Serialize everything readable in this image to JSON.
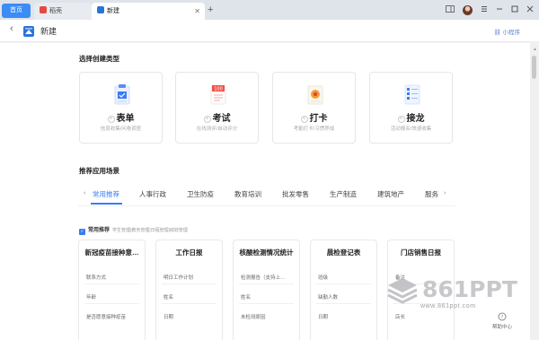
{
  "browser": {
    "home_tab": "首页",
    "tabs": [
      {
        "label": "稻壳",
        "active": false,
        "icon_color": "#e5483f",
        "icon": "daoke-icon"
      },
      {
        "label": "新建",
        "active": true,
        "icon_color": "#2a74d8",
        "icon": "app-icon"
      }
    ],
    "add_tab": "+",
    "close_glyph": "✕",
    "accent": "#3b8cf5"
  },
  "header": {
    "back": "‹",
    "title": "新建",
    "mini_program": "小程序"
  },
  "create_section": {
    "title": "选择创建类型",
    "cards": [
      {
        "label": "表单",
        "desc": "信息收集/问卷调查",
        "icon": "form-icon"
      },
      {
        "label": "考试",
        "desc": "在线测评/自动评分",
        "icon": "exam-icon"
      },
      {
        "label": "打卡",
        "desc": "考勤打卡/习惯养成",
        "icon": "checkin-icon"
      },
      {
        "label": "接龙",
        "desc": "活动报名/快速收集",
        "icon": "relay-icon"
      }
    ]
  },
  "scenario_section": {
    "title": "推荐应用场景",
    "tabs": [
      "常用推荐",
      "人事行政",
      "卫生防疫",
      "教育培训",
      "批发零售",
      "生产制造",
      "建筑地产",
      "服务"
    ],
    "active_tab": "常用推荐",
    "prev_arrow": "‹",
    "next_arrow": "›"
  },
  "common": {
    "label": "常用推荐",
    "desc": "学生管理|教务管理|日程管理|绩效管理"
  },
  "templates": [
    {
      "title": "新冠疫苗接种意…",
      "fields": [
        "联系方式",
        "年龄",
        "是否愿意接种疫苗"
      ]
    },
    {
      "title": "工作日报",
      "fields": [
        "明日工作计划",
        "姓名",
        "日期"
      ]
    },
    {
      "title": "核酸检测情况统计",
      "fields": [
        "检测报告（支持上…",
        "姓名",
        "未检测原因"
      ]
    },
    {
      "title": "晨检登记表",
      "fields": [
        "班级",
        "缺勤人数",
        "日期"
      ]
    },
    {
      "title": "门店销售日报",
      "fields": [
        "备注",
        "",
        "店长"
      ]
    }
  ],
  "watermark": {
    "brand": "861PPT",
    "url": "www.861ppt.com"
  },
  "help": "帮助中心"
}
